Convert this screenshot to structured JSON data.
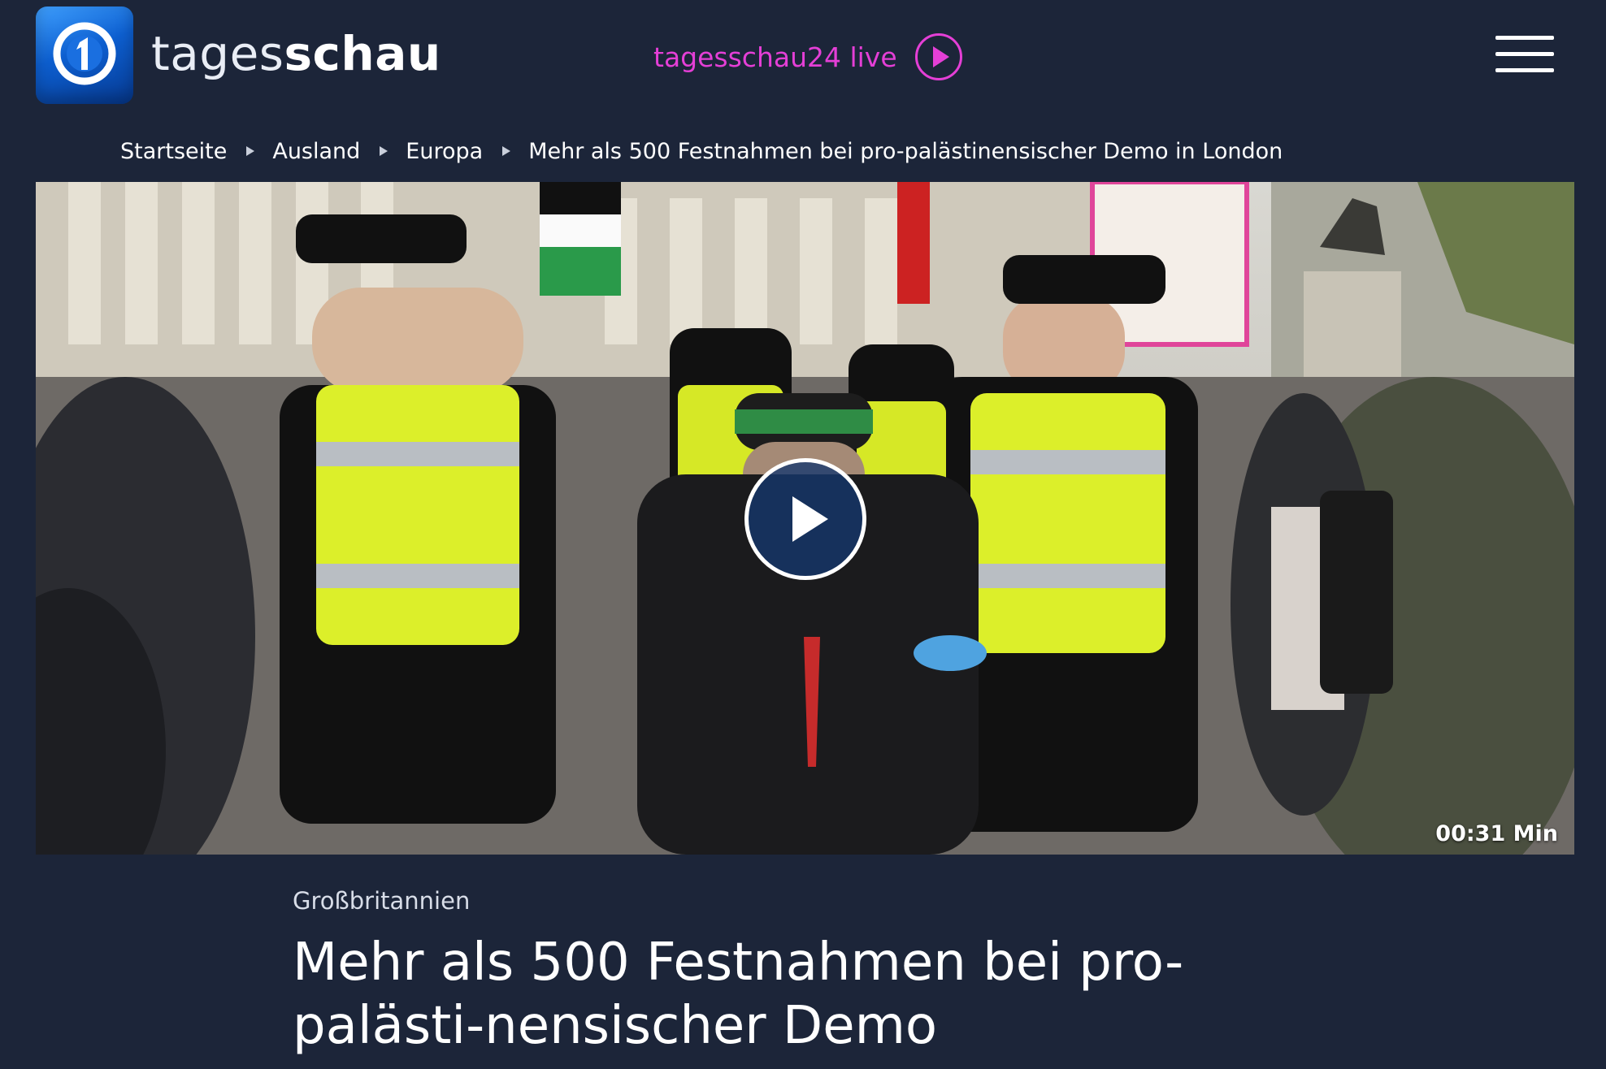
{
  "header": {
    "logo_icon": "ard-1-logo-icon",
    "brand_light": "tages",
    "brand_bold": "schau",
    "live_label": "tagesschau24 live",
    "live_icon": "play-circle-icon",
    "menu_icon": "hamburger-menu-icon",
    "accent_color": "#e43fd6",
    "background_color": "#1c2539"
  },
  "breadcrumb": {
    "items": [
      {
        "label": "Startseite"
      },
      {
        "label": "Ausland"
      },
      {
        "label": "Europa"
      },
      {
        "label": "Mehr als 500 Festnahmen bei pro-palästinensischer Demo in London"
      }
    ],
    "separator_icon": "triangle-right-icon"
  },
  "video": {
    "play_icon": "play-icon",
    "duration": "00:31 Min"
  },
  "article": {
    "topline": "Großbritannien",
    "headline": "Mehr als 500 Festnahmen bei pro-palästi-nensischer Demo"
  }
}
